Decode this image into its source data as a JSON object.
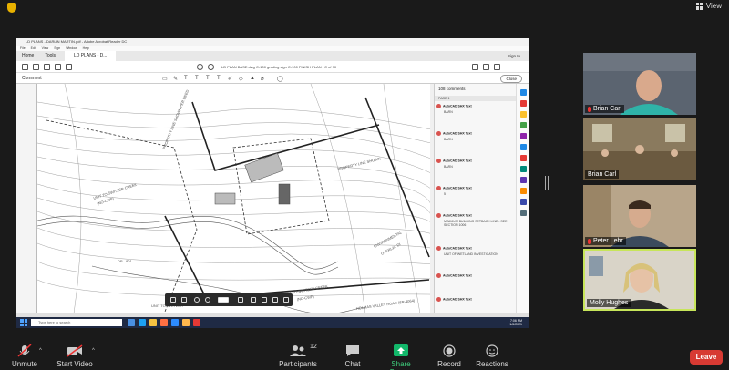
{
  "zoom_top": {
    "view_label": "View"
  },
  "shared": {
    "acrobat_title": "LD PLANS - DARLIN MARTIN.pdf - Adobe Acrobat Reader DC",
    "menu": [
      "File",
      "Edit",
      "View",
      "Sign",
      "Window",
      "Help"
    ],
    "tabs": {
      "home": "Home",
      "tools": "Tools",
      "doc": "LD PLANS - D..."
    },
    "sign_in": "Sign In",
    "page_info": "LD PLAN BASE.dwg C-100 grading sign C-100 FINISH PLAN - C of 90",
    "comment_label": "Comment",
    "close_label": "Close",
    "comments_count": "108 comments",
    "page_label": "PAGE 1",
    "comments": [
      {
        "who": "AutoCAD SHX Text",
        "text": "BARN"
      },
      {
        "who": "AutoCAD SHX Text",
        "text": "BARN"
      },
      {
        "who": "AutoCAD SHX Text",
        "text": "BARN"
      },
      {
        "who": "AutoCAD SHX Text",
        "text": "5"
      },
      {
        "who": "AutoCAD SHX Text",
        "text": "MINIMUM BUILDING SETBACK LINE - SEE SECTION 1006"
      },
      {
        "who": "AutoCAD SHX Text",
        "text": "UNIT OF WETLAND INVESTIGATION"
      },
      {
        "who": "AutoCAD SHX Text",
        "text": ""
      },
      {
        "who": "AutoCAD SHX Text",
        "text": ""
      }
    ],
    "drawing_labels": {
      "unit_switzer_left": "UNIT TO SWITZER CREEK",
      "unit_switzer_left2": "(NO-CWF)",
      "unit_switzer_mid": "UNIT TO SWITZER CREEK",
      "unit_switzer_mid2": "(NO-CWF)",
      "unit_switzer_bottom": "UNIT TO SWITZER",
      "property_line_brown": "PROPERTY LINE SHOWN PER DEED",
      "property_line_right": "PROPERTY LINE SHOWN",
      "environmental": "ENVIRONMENTAL",
      "overlay": "OVERLAY DI",
      "road": "HOLMAS VALLEY ROAD (SR-4064)",
      "dp": "DP - 801"
    },
    "taskbar": {
      "search_placeholder": "Type here to search",
      "time": "7:06 PM",
      "date": "1/6/2021"
    }
  },
  "participants": [
    {
      "name": "Brian Carl",
      "muted": true
    },
    {
      "name": "Brian Carl",
      "muted": false
    },
    {
      "name": "Peter Lehr",
      "muted": true
    },
    {
      "name": "Molly Hughes",
      "muted": false,
      "active": true
    }
  ],
  "toolbar": {
    "unmute": "Unmute",
    "start_video": "Start Video",
    "participants": "Participants",
    "participants_count": "12",
    "chat": "Chat",
    "share_screen": "Share Screen",
    "record": "Record",
    "reactions": "Reactions",
    "leave": "Leave"
  }
}
